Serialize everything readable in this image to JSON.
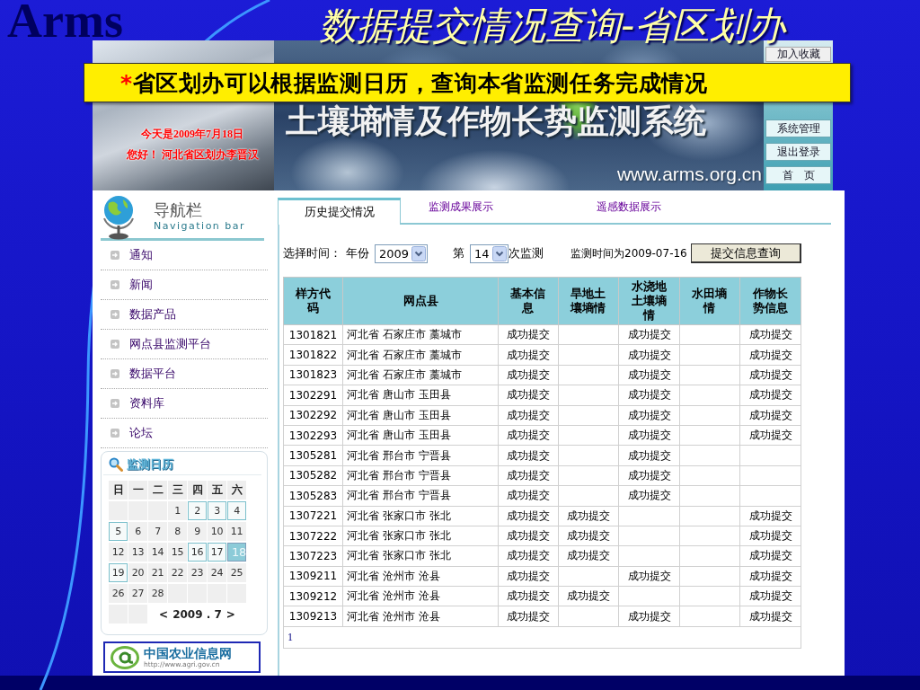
{
  "slide": {
    "logo": "Arms",
    "title": "数据提交情况查询-省区划办",
    "callout": {
      "marker": "*",
      "text": "省区划办可以根据监测日历，查询本省监测任务完成情况"
    }
  },
  "banner": {
    "date_text": "今天是2009年7月18日",
    "greeting": "您好！ 河北省区划办李晋汉",
    "system_title": "土壤墒情及作物长势监测系统",
    "url": "www.arms.org.cn",
    "top_button": "加入收藏",
    "buttons": [
      "系统管理",
      "退出登录",
      "首　页"
    ]
  },
  "sidebar": {
    "nav_title": "导航栏",
    "nav_subtitle": "Navigation bar",
    "items": [
      "通知",
      "新闻",
      "数据产品",
      "网点县监测平台",
      "数据平台",
      "资料库",
      "论坛"
    ],
    "calendar": {
      "title": "监测日历",
      "weekdays": [
        "日",
        "一",
        "二",
        "三",
        "四",
        "五",
        "六"
      ],
      "weeks": [
        [
          {
            "kind": "blank"
          },
          {
            "kind": "blank"
          },
          {
            "kind": "blank"
          },
          {
            "kind": "day",
            "day": "1",
            "marked": false,
            "selected": false
          },
          {
            "kind": "day",
            "day": "2",
            "marked": true,
            "selected": false
          },
          {
            "kind": "day",
            "day": "3",
            "marked": true,
            "selected": false
          },
          {
            "kind": "day",
            "day": "4",
            "marked": true,
            "selected": false
          }
        ],
        [
          {
            "kind": "day",
            "day": "5",
            "marked": true,
            "selected": false
          },
          {
            "kind": "day",
            "day": "6",
            "marked": false,
            "selected": false
          },
          {
            "kind": "day",
            "day": "7",
            "marked": false,
            "selected": false
          },
          {
            "kind": "day",
            "day": "8",
            "marked": false,
            "selected": false
          },
          {
            "kind": "day",
            "day": "9",
            "marked": false,
            "selected": false
          },
          {
            "kind": "day",
            "day": "10",
            "marked": false,
            "selected": false
          },
          {
            "kind": "day",
            "day": "11",
            "marked": false,
            "selected": false
          }
        ],
        [
          {
            "kind": "day",
            "day": "12",
            "marked": false,
            "selected": false
          },
          {
            "kind": "day",
            "day": "13",
            "marked": false,
            "selected": false
          },
          {
            "kind": "day",
            "day": "14",
            "marked": false,
            "selected": false
          },
          {
            "kind": "day",
            "day": "15",
            "marked": false,
            "selected": false
          },
          {
            "kind": "day",
            "day": "16",
            "marked": true,
            "selected": false
          },
          {
            "kind": "day",
            "day": "17",
            "marked": true,
            "selected": false
          },
          {
            "kind": "day",
            "day": "18",
            "marked": false,
            "selected": true
          }
        ],
        [
          {
            "kind": "day",
            "day": "19",
            "marked": true,
            "selected": false
          },
          {
            "kind": "day",
            "day": "20",
            "marked": false,
            "selected": false
          },
          {
            "kind": "day",
            "day": "21",
            "marked": false,
            "selected": false
          },
          {
            "kind": "day",
            "day": "22",
            "marked": false,
            "selected": false
          },
          {
            "kind": "day",
            "day": "23",
            "marked": false,
            "selected": false
          },
          {
            "kind": "day",
            "day": "24",
            "marked": false,
            "selected": false
          },
          {
            "kind": "day",
            "day": "25",
            "marked": false,
            "selected": false
          }
        ],
        [
          {
            "kind": "day",
            "day": "26",
            "marked": false,
            "selected": false
          },
          {
            "kind": "day",
            "day": "27",
            "marked": false,
            "selected": false
          },
          {
            "kind": "day",
            "day": "28",
            "marked": false,
            "selected": false
          },
          {
            "kind": "blank"
          },
          {
            "kind": "blank"
          },
          {
            "kind": "blank"
          },
          {
            "kind": "blank"
          }
        ],
        [
          {
            "kind": "blank"
          },
          {
            "kind": "blank"
          }
        ]
      ],
      "prev": "<",
      "month": "2009 . 7",
      "next": ">"
    },
    "partner_logo": {
      "name": "中国农业信息网",
      "url": "http://www.agri.gov.cn"
    }
  },
  "tabs": [
    {
      "label": "历史提交情况",
      "selected": true
    },
    {
      "label": "监测成果展示",
      "selected": false
    },
    {
      "label": "遥感数据展示",
      "selected": false
    }
  ],
  "filters": {
    "label": "选择时间：",
    "year_label": "年份",
    "year": "2009",
    "round_prefix": "第",
    "round": "14",
    "round_suffix": "次监测",
    "monitor_time": "监测时间为2009-07-16",
    "query_button": "提交信息查询"
  },
  "table": {
    "columns": [
      "样方代码",
      "网点县",
      "基本信息",
      "旱地土壤墒情",
      "水浇地土壤墒情",
      "水田墒情",
      "作物长势信息"
    ],
    "rows": [
      {
        "code": "1301821",
        "county": "河北省 石家庄市 藁城市",
        "basic_info": "成功提交",
        "irrigated_soil_moisture": "成功提交",
        "crop_growth": "成功提交"
      },
      {
        "code": "1301822",
        "county": "河北省 石家庄市 藁城市",
        "basic_info": "成功提交",
        "irrigated_soil_moisture": "成功提交",
        "crop_growth": "成功提交"
      },
      {
        "code": "1301823",
        "county": "河北省 石家庄市 藁城市",
        "basic_info": "成功提交",
        "irrigated_soil_moisture": "成功提交",
        "crop_growth": "成功提交"
      },
      {
        "code": "1302291",
        "county": "河北省 唐山市 玉田县",
        "basic_info": "成功提交",
        "irrigated_soil_moisture": "成功提交",
        "crop_growth": "成功提交"
      },
      {
        "code": "1302292",
        "county": "河北省 唐山市 玉田县",
        "basic_info": "成功提交",
        "irrigated_soil_moisture": "成功提交",
        "crop_growth": "成功提交"
      },
      {
        "code": "1302293",
        "county": "河北省 唐山市 玉田县",
        "basic_info": "成功提交",
        "irrigated_soil_moisture": "成功提交",
        "crop_growth": "成功提交"
      },
      {
        "code": "1305281",
        "county": "河北省 邢台市 宁晋县",
        "basic_info": "成功提交",
        "irrigated_soil_moisture": "成功提交"
      },
      {
        "code": "1305282",
        "county": "河北省 邢台市 宁晋县",
        "basic_info": "成功提交",
        "irrigated_soil_moisture": "成功提交"
      },
      {
        "code": "1305283",
        "county": "河北省 邢台市 宁晋县",
        "basic_info": "成功提交",
        "irrigated_soil_moisture": "成功提交"
      },
      {
        "code": "1307221",
        "county": "河北省 张家口市 张北",
        "basic_info": "成功提交",
        "dryland_soil_moisture": "成功提交",
        "crop_growth": "成功提交"
      },
      {
        "code": "1307222",
        "county": "河北省 张家口市 张北",
        "basic_info": "成功提交",
        "dryland_soil_moisture": "成功提交",
        "crop_growth": "成功提交"
      },
      {
        "code": "1307223",
        "county": "河北省 张家口市 张北",
        "basic_info": "成功提交",
        "dryland_soil_moisture": "成功提交",
        "crop_growth": "成功提交"
      },
      {
        "code": "1309211",
        "county": "河北省 沧州市 沧县",
        "basic_info": "成功提交",
        "irrigated_soil_moisture": "成功提交",
        "crop_growth": "成功提交"
      },
      {
        "code": "1309212",
        "county": "河北省 沧州市 沧县",
        "basic_info": "成功提交",
        "dryland_soil_moisture": "成功提交",
        "crop_growth": "成功提交"
      },
      {
        "code": "1309213",
        "county": "河北省 沧州市 沧县",
        "basic_info": "成功提交",
        "irrigated_soil_moisture": "成功提交",
        "crop_growth": "成功提交"
      }
    ],
    "pages": [
      "1"
    ]
  }
}
